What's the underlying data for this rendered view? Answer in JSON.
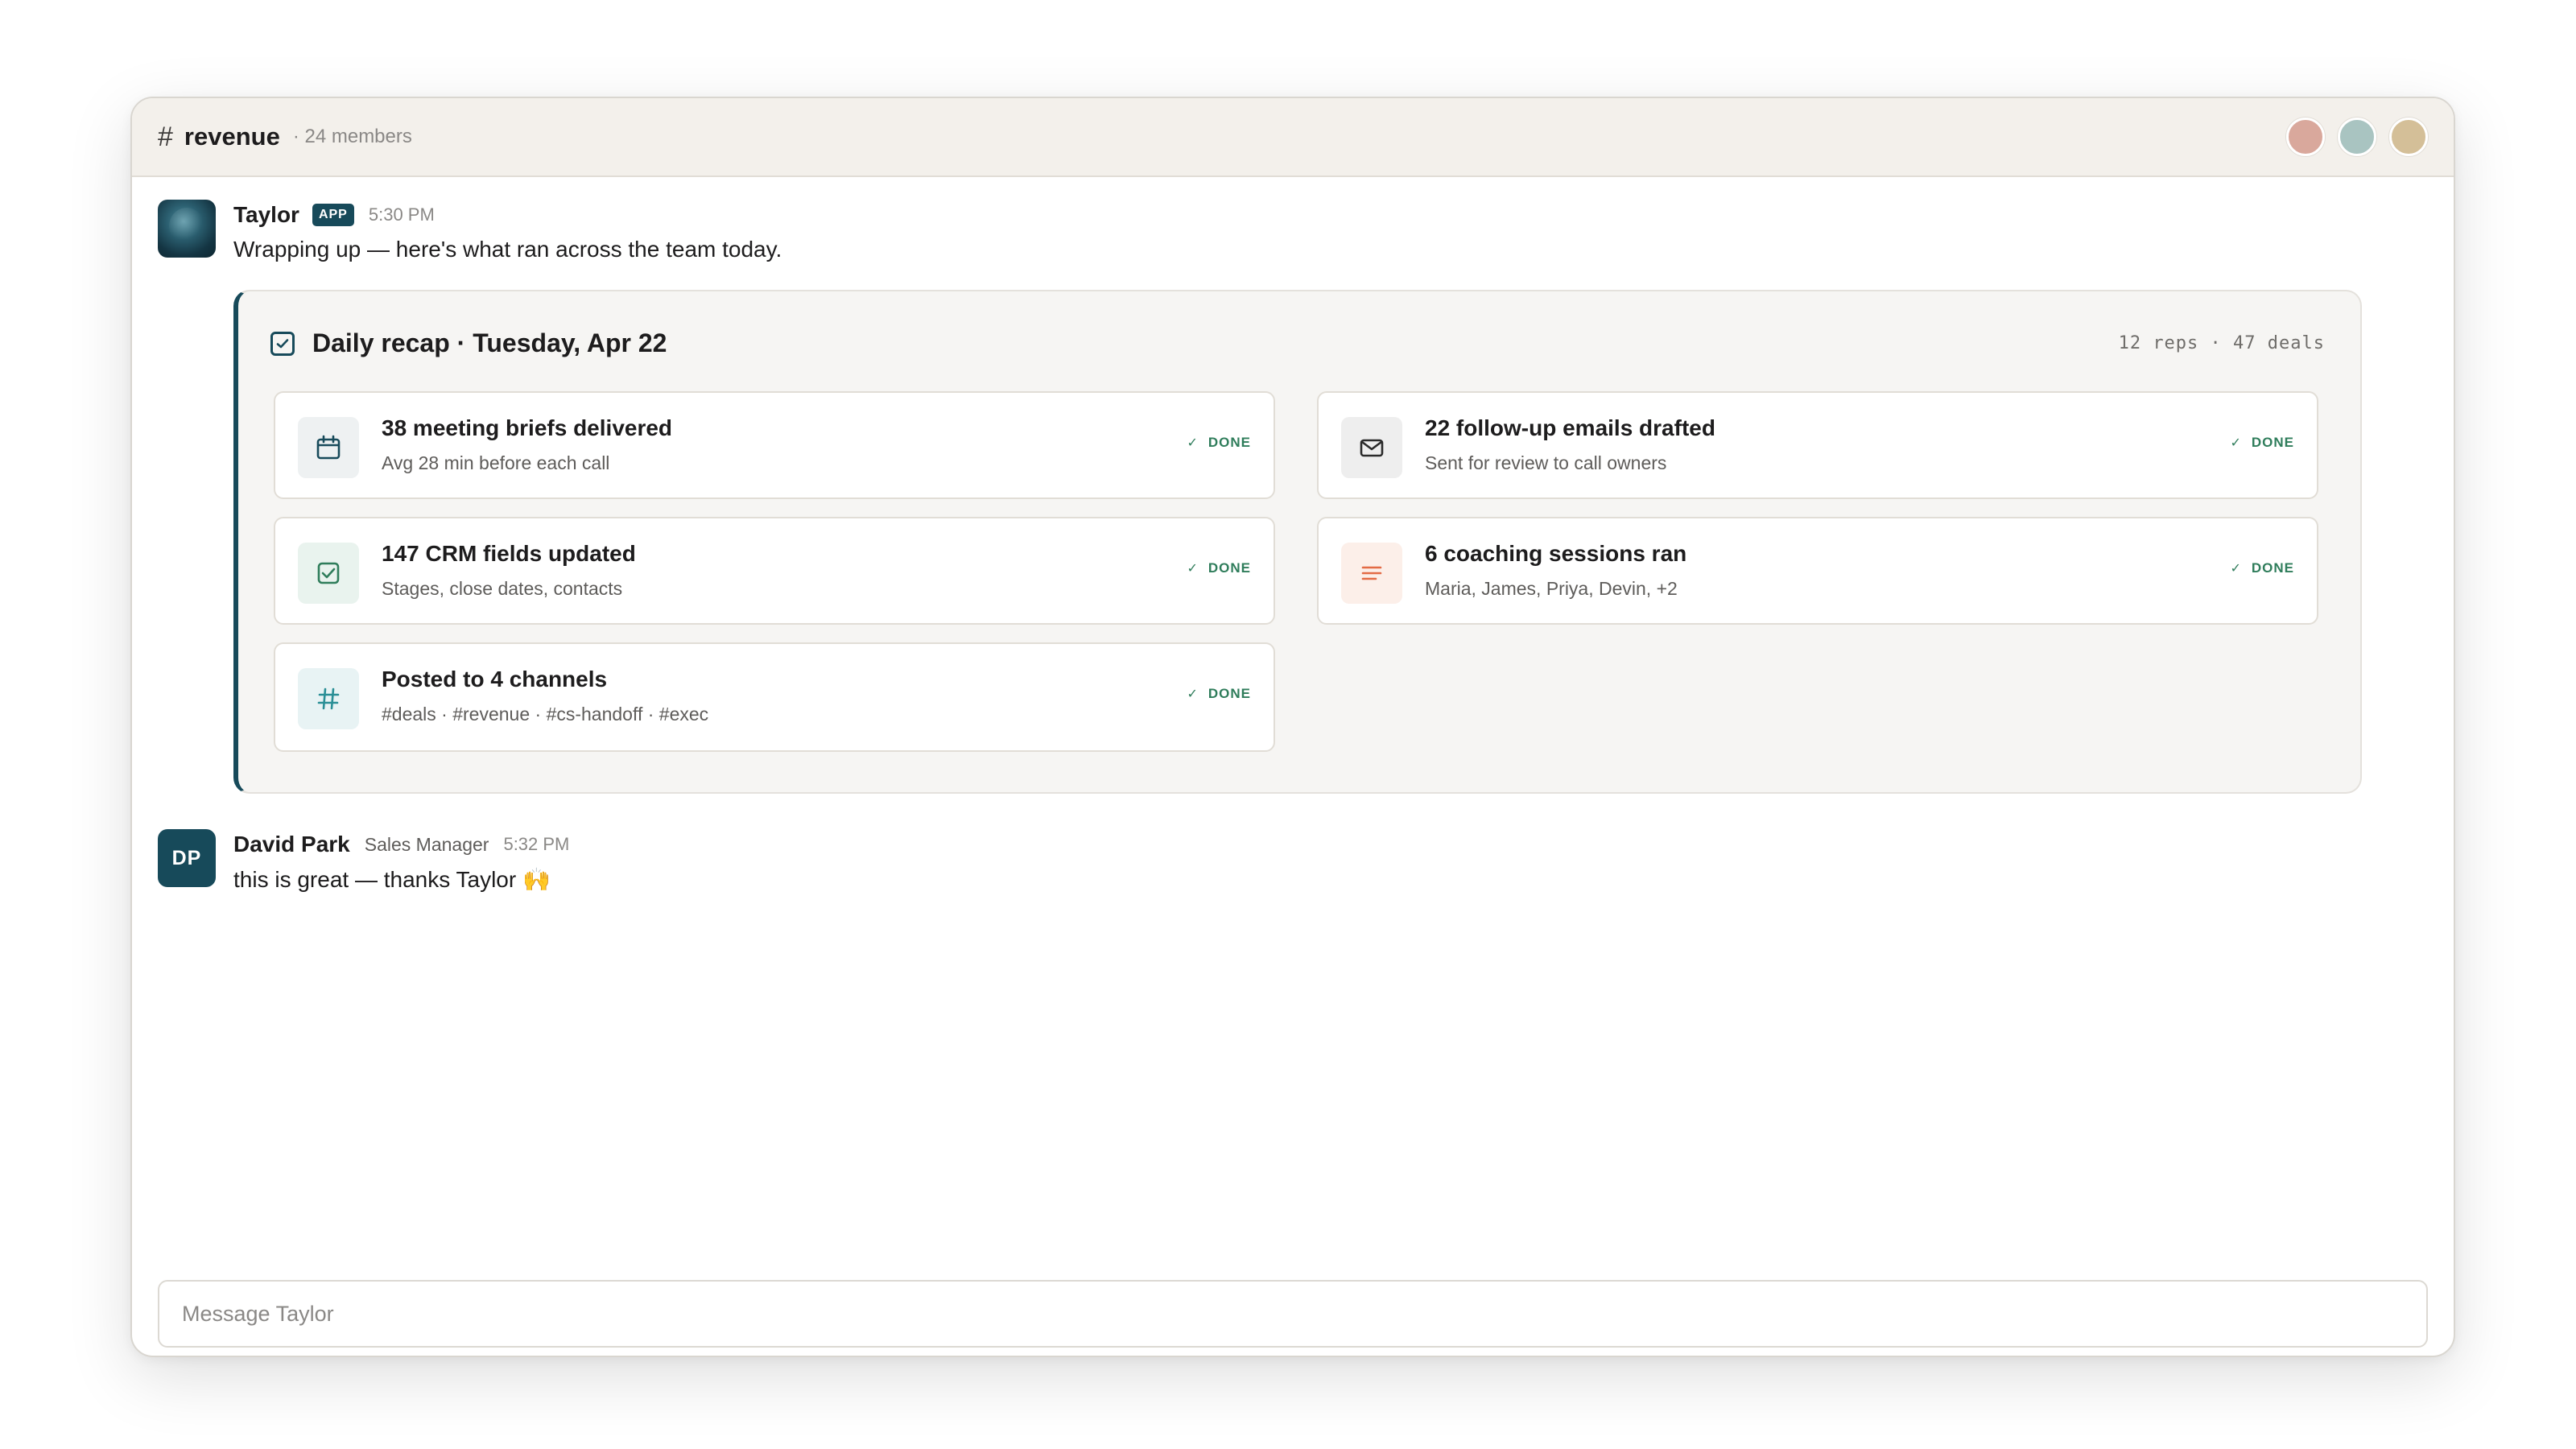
{
  "channel": {
    "hash": "#",
    "name": "revenue",
    "members_text": "· 24 members",
    "member_avatar_colors": [
      "#d9a89c",
      "#a9c4c1",
      "#d4bf98"
    ]
  },
  "messages": [
    {
      "author": "Taylor",
      "badge": "APP",
      "time": "5:30 PM",
      "text": "Wrapping up — here's what ran across the team today."
    },
    {
      "author": "David Park",
      "initials": "DP",
      "role": "Sales Manager",
      "time": "5:32 PM",
      "text": "this is great — thanks Taylor 🙌"
    }
  ],
  "recap": {
    "title": "Daily recap · Tuesday, Apr 22",
    "stats": "12 reps · 47 deals",
    "check_mark": "✓",
    "tasks": [
      {
        "title": "38 meeting briefs delivered",
        "subtitle": "Avg 28 min before each call",
        "status": "DONE",
        "icon": "calendar-icon"
      },
      {
        "title": "22 follow-up emails drafted",
        "subtitle": "Sent for review to call owners",
        "status": "DONE",
        "icon": "mail-icon"
      },
      {
        "title": "147 CRM fields updated",
        "subtitle": "Stages, close dates, contacts",
        "status": "DONE",
        "icon": "checkbox-icon"
      },
      {
        "title": "6 coaching sessions ran",
        "subtitle": "Maria, James, Priya, Devin, +2",
        "status": "DONE",
        "icon": "list-lines-icon"
      },
      {
        "title": "Posted to 4 channels",
        "subtitle": "#deals · #revenue · #cs-handoff · #exec",
        "status": "DONE",
        "icon": "hash-icon"
      }
    ]
  },
  "composer": {
    "placeholder": "Message Taylor"
  },
  "colors": {
    "accent": "#174a5a",
    "done": "#2f7d5b",
    "coral": "#e36b45",
    "teal": "#2a8f96"
  }
}
